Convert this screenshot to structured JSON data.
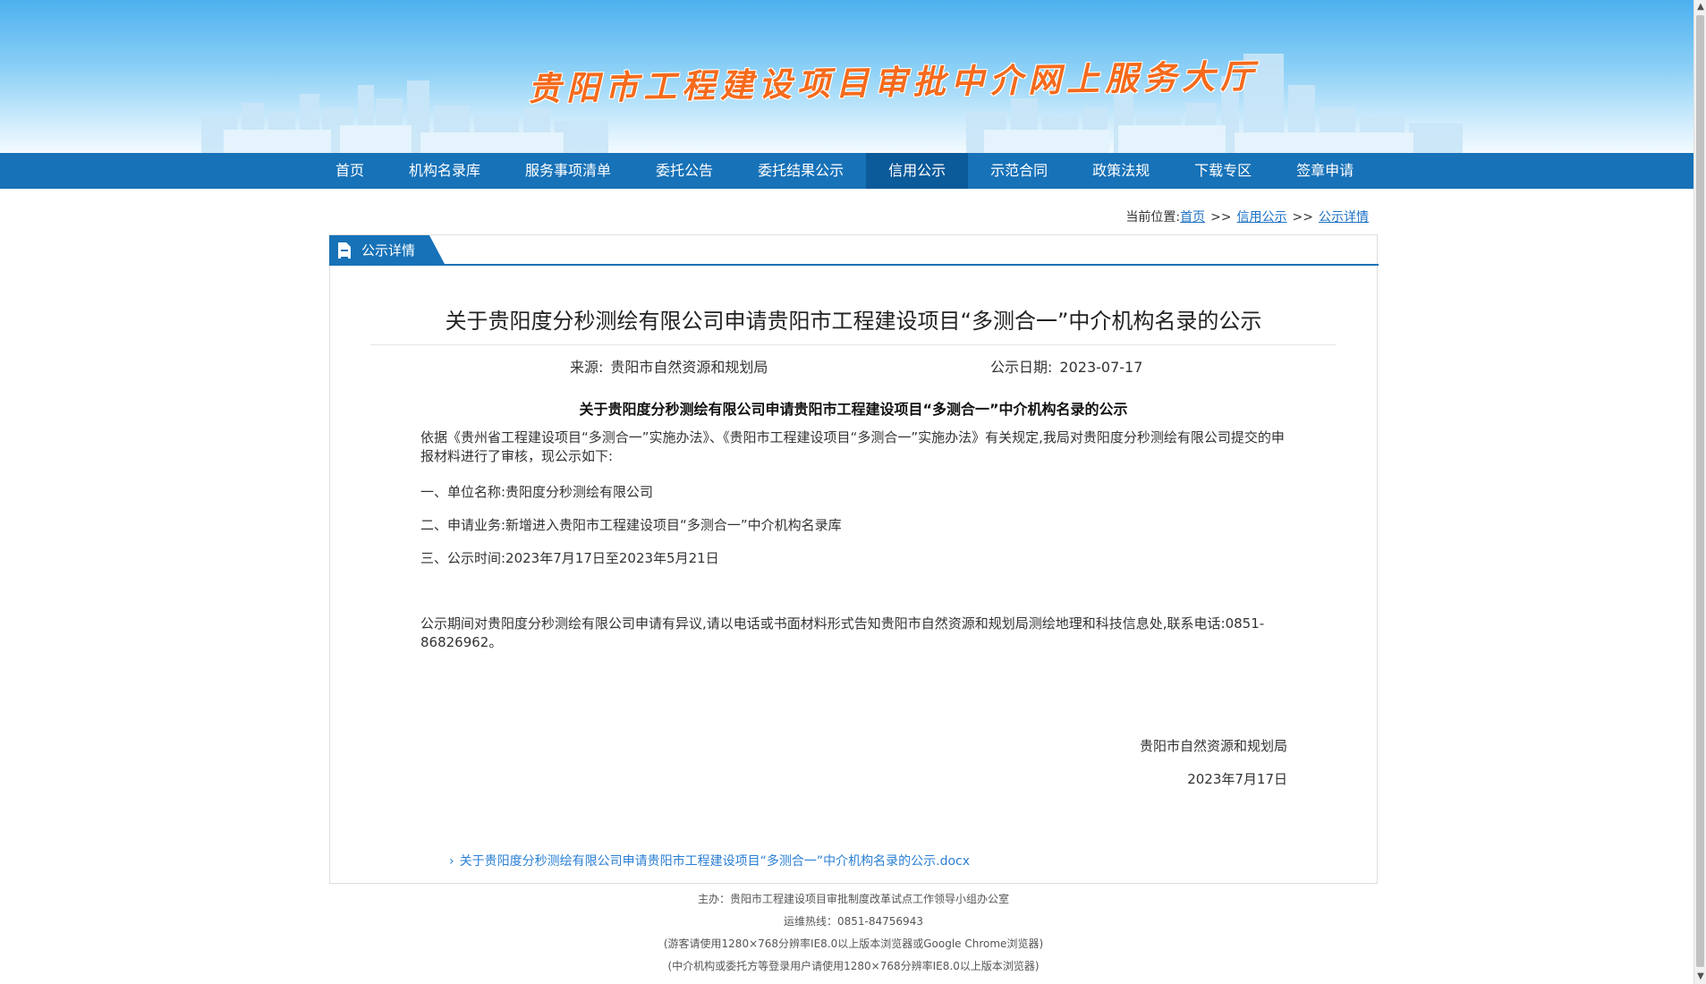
{
  "banner": {
    "site_title": "贵阳市工程建设项目审批中介网上服务大厅"
  },
  "nav": {
    "items": [
      {
        "label": "首页"
      },
      {
        "label": "机构名录库"
      },
      {
        "label": "服务事项清单"
      },
      {
        "label": "委托公告"
      },
      {
        "label": "委托结果公示"
      },
      {
        "label": "信用公示"
      },
      {
        "label": "示范合同"
      },
      {
        "label": "政策法规"
      },
      {
        "label": "下载专区"
      },
      {
        "label": "签章申请"
      }
    ],
    "active_index": 5
  },
  "breadcrumb": {
    "prefix": "当前位置:",
    "items": [
      "首页",
      "信用公示",
      "公示详情"
    ],
    "separator": ">>"
  },
  "panel": {
    "tab_label": "公示详情"
  },
  "article": {
    "title": "关于贵阳度分秒测绘有限公司申请贵阳市工程建设项目“多测合一”中介机构名录的公示",
    "source_label": "来源:",
    "source_value": "贵阳市自然资源和规划局",
    "date_label": "公示日期:",
    "date_value": "2023-07-17",
    "sub_title": "关于贵阳度分秒测绘有限公司申请贵阳市工程建设项目“多测合一”中介机构名录的公示",
    "paragraphs": [
      " 依据《贵州省工程建设项目“多测合一”实施办法》、《贵阳市工程建设项目“多测合一”实施办法》有关规定,我局对贵阳度分秒测绘有限公司提交的申报材料进行了审核，现公示如下:",
      "一、单位名称:贵阳度分秒测绘有限公司",
      "二、申请业务:新增进入贵阳市工程建设项目“多测合一”中介机构名录库",
      " 三、公示时间:2023年7月17日至2023年5月21日",
      "公示期间对贵阳度分秒测绘有限公司申请有异议,请以电话或书面材料形式告知贵阳市自然资源和规划局测绘地理和科技信息处,联系电话:0851-86826962。"
    ],
    "sign_org": "贵阳市自然资源和规划局",
    "sign_date": "2023年7月17日",
    "attachment": "关于贵阳度分秒测绘有限公司申请贵阳市工程建设项目“多测合一”中介机构名录的公示.docx"
  },
  "footer": {
    "lines": [
      "主办：贵阳市工程建设项目审批制度改革试点工作领导小组办公室",
      "运维热线：0851-84756943",
      "(游客请使用1280×768分辨率IE8.0以上版本浏览器或Google Chrome浏览器)",
      "(中介机构或委托方等登录用户请使用1280×768分辨率IE8.0以上版本浏览器)"
    ]
  },
  "colors": {
    "nav_bg": "#1772b8",
    "nav_active": "#0b5a99",
    "title_orange": "#f56a1c",
    "link_blue": "#1a6fc4"
  },
  "icons": {
    "tab_icon": "document-icon",
    "attachment_icon": "chevron-right-icon",
    "scroll_up": "chevron-up-icon",
    "scroll_down": "chevron-down-icon"
  }
}
